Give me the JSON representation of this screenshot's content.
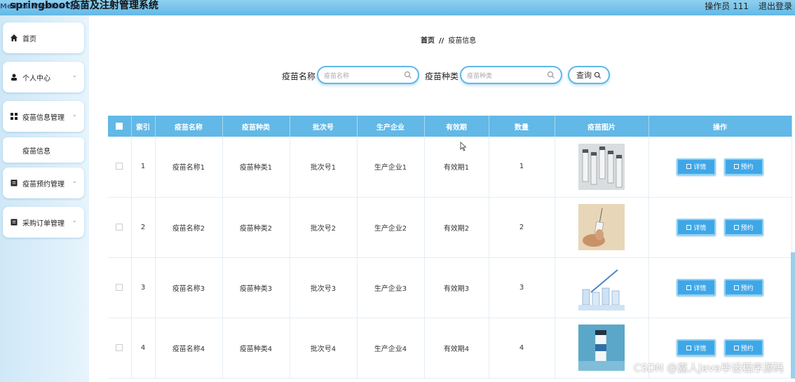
{
  "header": {
    "title": "springboot疫苗及注射管理系统",
    "title_overlay": "Medical Vaccine Clinic",
    "user": "操作员 111",
    "logout": "退出登录"
  },
  "sidebar": {
    "items": [
      {
        "label": "首页",
        "icon": "home-icon"
      },
      {
        "label": "个人中心",
        "icon": "user-icon"
      },
      {
        "label": "疫苗信息管理",
        "icon": "grid-icon"
      },
      {
        "label": "疫苗信息",
        "icon": ""
      },
      {
        "label": "疫苗预约管理",
        "icon": "doc-icon"
      },
      {
        "label": "采购订单管理",
        "icon": "doc-icon"
      }
    ]
  },
  "breadcrumb": {
    "home": "首页",
    "sep": "//",
    "current": "疫苗信息"
  },
  "search": {
    "name_label": "疫苗名称",
    "name_placeholder": "疫苗名称",
    "type_label": "疫苗种类",
    "type_placeholder": "疫苗种类",
    "query_label": "查询"
  },
  "table": {
    "headers": [
      "",
      "索引",
      "疫苗名称",
      "疫苗种类",
      "批次号",
      "生产企业",
      "有效期",
      "数量",
      "疫苗图片",
      "操作"
    ],
    "rows": [
      {
        "index": "1",
        "name": "疫苗名称1",
        "type": "疫苗种类1",
        "batch": "批次号1",
        "maker": "生产企业1",
        "expiry": "有效期1",
        "qty": "1",
        "image": "vials-image"
      },
      {
        "index": "2",
        "name": "疫苗名称2",
        "type": "疫苗种类2",
        "batch": "批次号2",
        "maker": "生产企业2",
        "expiry": "有效期2",
        "qty": "2",
        "image": "syringe-hand-image"
      },
      {
        "index": "3",
        "name": "疫苗名称3",
        "type": "疫苗种类3",
        "batch": "批次号3",
        "maker": "生产企业3",
        "expiry": "有效期3",
        "qty": "3",
        "image": "syringe-vials-image"
      },
      {
        "index": "4",
        "name": "疫苗名称4",
        "type": "疫苗种类4",
        "batch": "批次号4",
        "maker": "生产企业4",
        "expiry": "有效期4",
        "qty": "4",
        "image": "vial-blue-image"
      }
    ],
    "detail_label": "详情",
    "book_label": "预约"
  },
  "watermark": "CSDN @嘉人Java毕设程序源码",
  "colors": {
    "accent": "#62b8e6",
    "button": "#3fa7e8"
  }
}
